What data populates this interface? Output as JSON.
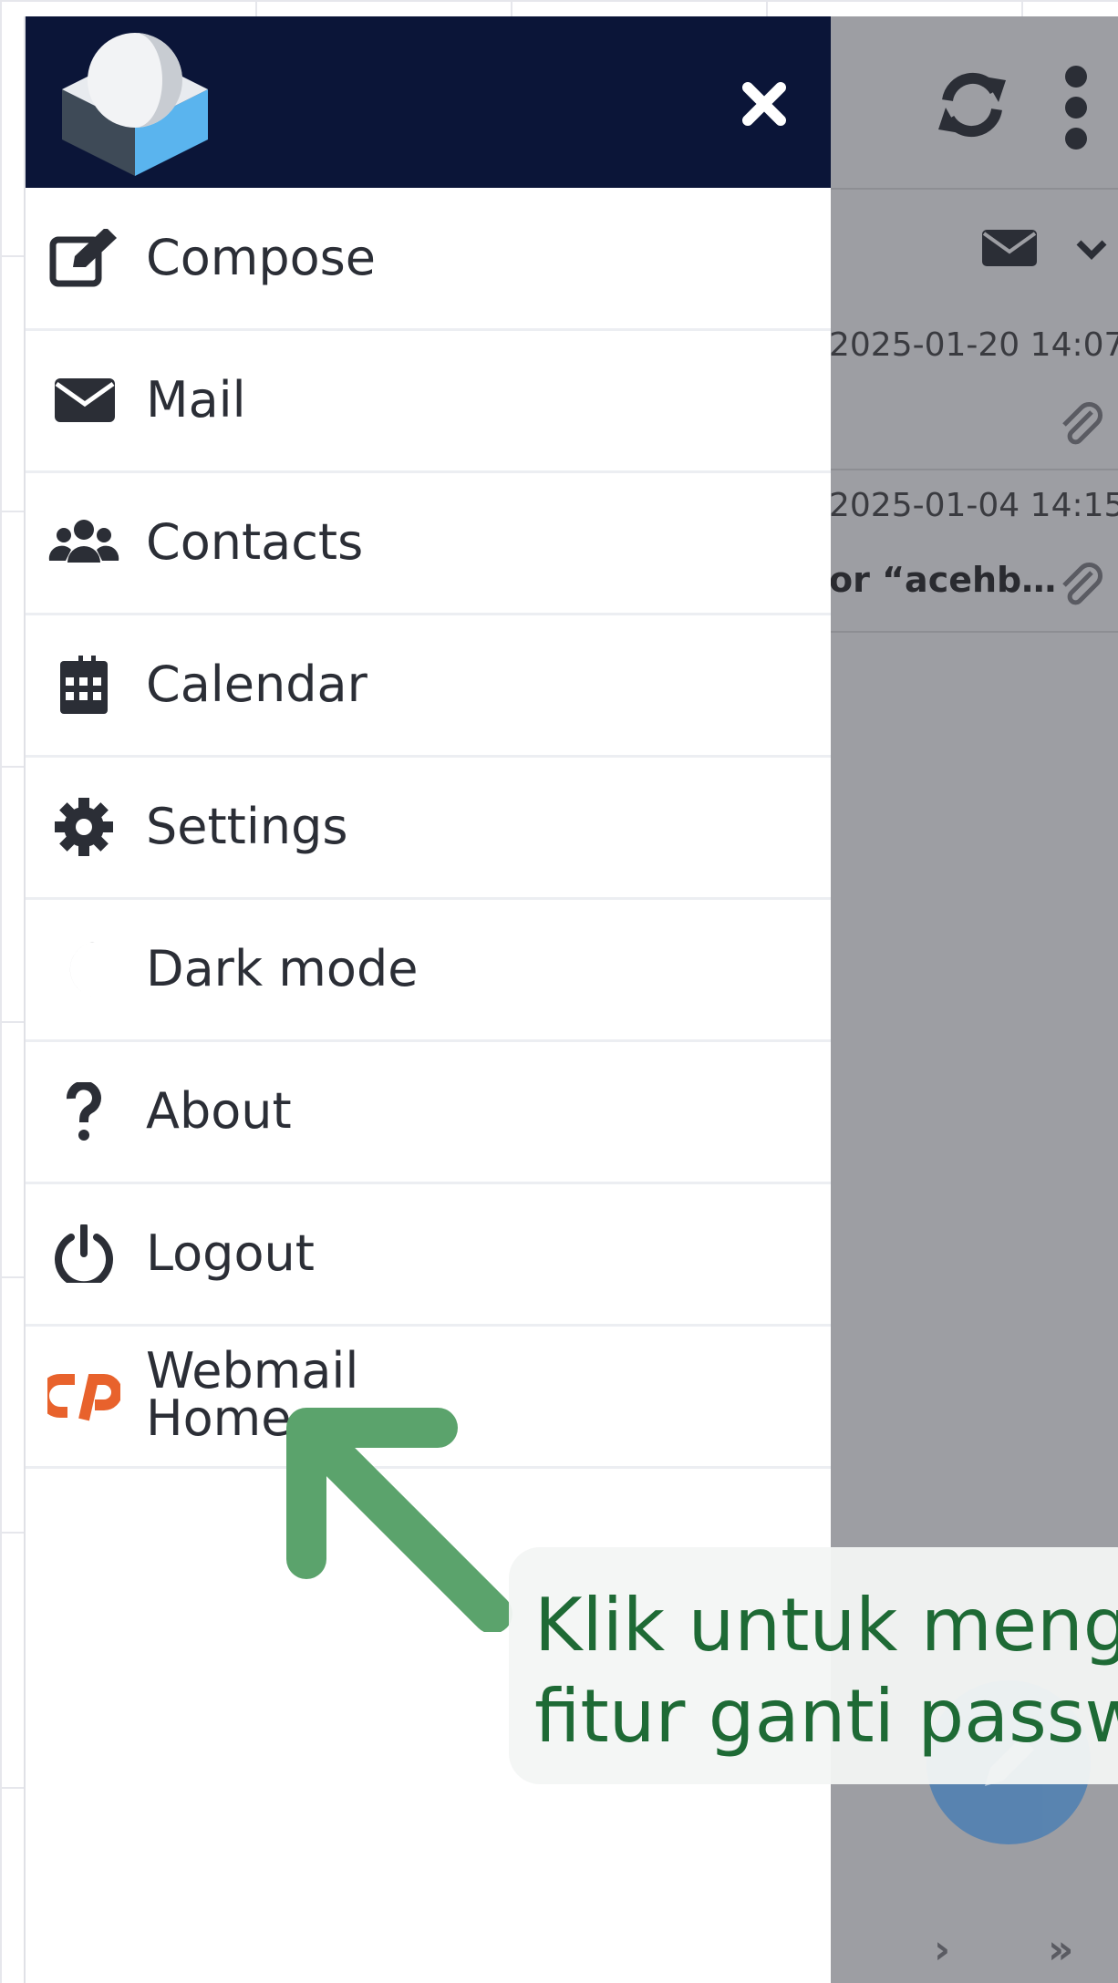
{
  "drawer": {
    "menu_items": [
      {
        "label": "Compose",
        "icon": "compose-icon"
      },
      {
        "label": "Mail",
        "icon": "mail-icon"
      },
      {
        "label": "Contacts",
        "icon": "contacts-icon"
      },
      {
        "label": "Calendar",
        "icon": "calendar-icon"
      },
      {
        "label": "Settings",
        "icon": "gear-icon"
      },
      {
        "label": "Dark mode",
        "icon": "moon-icon"
      },
      {
        "label": "About",
        "icon": "question-icon"
      },
      {
        "label": "Logout",
        "icon": "power-icon"
      },
      {
        "label": "Webmail Home",
        "icon": "cpanel-icon"
      }
    ],
    "colors": {
      "header": "#0b1538",
      "accent": "#e8622c"
    }
  },
  "mail_list": {
    "messages": [
      {
        "date": "2025-01-20 14:07",
        "subject": "",
        "has_attachment": true
      },
      {
        "date": "2025-01-04 14:15",
        "subject": "or “acehb…",
        "has_attachment": true
      }
    ],
    "pager": {
      "next": "›",
      "last": "»"
    }
  },
  "annotation": {
    "text_line1": "Klik untuk meng",
    "text_line2": "fitur ganti passw",
    "color": "#1e6a35"
  }
}
